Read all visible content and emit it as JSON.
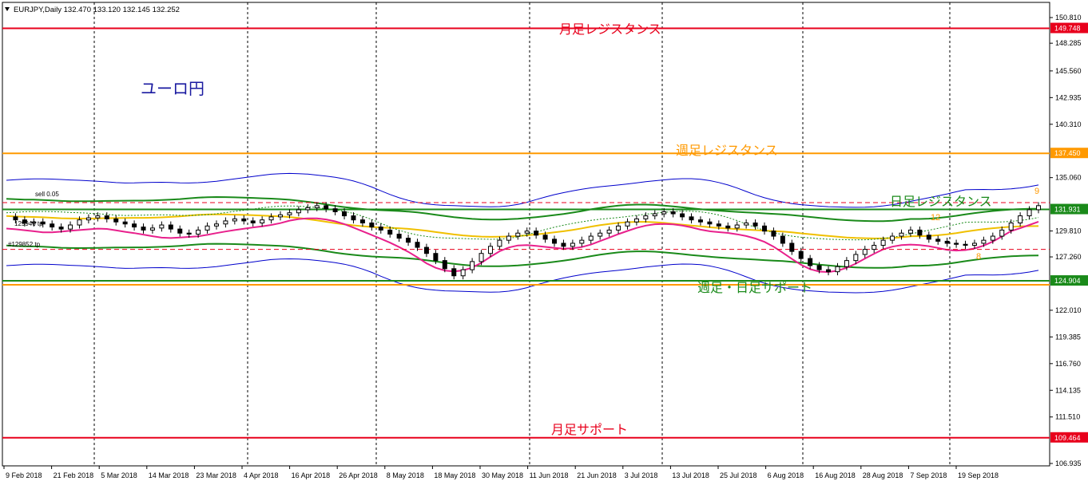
{
  "header": {
    "icon": "triangle-down-icon",
    "text": "EURJPY,Daily  132.470 133.120 132.145 132.252"
  },
  "annotations": {
    "title": "ユーロ円",
    "monthly_resistance": "月足レジスタンス",
    "weekly_resistance": "週足レジスタンス",
    "daily_resistance": "日足レジスタンス",
    "weekly_daily_support": "週足・日足サポート",
    "monthly_support": "月足サポート",
    "sell_label": "sell 0.05",
    "tp1": "129946 tp",
    "tp2": "#129852 tp",
    "count_12": "12",
    "count_9": "9",
    "count_8": "8"
  },
  "colors": {
    "red": "#e8001c",
    "orange": "#ff9900",
    "green": "#1a8a1a",
    "blue": "#0000cc",
    "magenta": "#e8208c",
    "yellow": "#f0c000",
    "title_blue": "#1a1aa0"
  },
  "chart_data": {
    "type": "line",
    "y_ticks": [
      "150.810",
      "149.748",
      "148.285",
      "145.560",
      "142.935",
      "140.310",
      "137.450",
      "135.060",
      "131.931",
      "129.810",
      "127.260",
      "124.904",
      "122.010",
      "119.385",
      "116.760",
      "114.135",
      "111.510",
      "109.464",
      "106.935"
    ],
    "ylim": [
      106.3,
      151.5
    ],
    "x_ticks": [
      "9 Feb 2018",
      "21 Feb 2018",
      "5 Mar 2018",
      "14 Mar 2018",
      "23 Mar 2018",
      "4 Apr 2018",
      "16 Apr 2018",
      "26 Apr 2018",
      "8 May 2018",
      "18 May 2018",
      "30 May 2018",
      "11 Jun 2018",
      "21 Jun 2018",
      "3 Jul 2018",
      "13 Jul 2018",
      "25 Jul 2018",
      "6 Aug 2018",
      "16 Aug 2018",
      "28 Aug 2018",
      "7 Sep 2018",
      "19 Sep 2018"
    ],
    "levels": [
      {
        "value": 149.748,
        "label": "149.748",
        "color": "#e8001c"
      },
      {
        "value": 137.45,
        "label": "137.450",
        "color": "#ff9900"
      },
      {
        "value": 131.931,
        "label": "131.931",
        "color": "#1a8a1a"
      },
      {
        "value": 124.904,
        "label": "124.904",
        "color": "#1a8a1a"
      },
      {
        "value": 109.464,
        "label": "109.464",
        "color": "#e8001c"
      }
    ],
    "close_series": [
      131.2,
      130.9,
      130.6,
      130.7,
      130.5,
      130.2,
      130.0,
      130.4,
      130.9,
      131.1,
      131.3,
      131.0,
      130.7,
      130.5,
      130.2,
      129.9,
      130.1,
      130.4,
      130.0,
      129.6,
      129.5,
      129.9,
      130.3,
      130.5,
      130.8,
      131.0,
      130.8,
      130.6,
      130.9,
      131.2,
      131.4,
      131.6,
      131.9,
      132.1,
      132.3,
      132.0,
      131.7,
      131.3,
      130.9,
      130.6,
      130.2,
      129.9,
      129.5,
      129.1,
      128.7,
      128.2,
      127.6,
      126.9,
      126.1,
      125.4,
      126.0,
      126.8,
      127.6,
      128.3,
      128.9,
      129.3,
      129.6,
      129.8,
      129.4,
      129.0,
      128.6,
      128.3,
      128.6,
      128.9,
      129.3,
      129.6,
      129.9,
      130.3,
      130.7,
      131.0,
      131.3,
      131.5,
      131.7,
      131.5,
      131.2,
      130.9,
      130.7,
      130.5,
      130.3,
      130.1,
      130.4,
      130.6,
      130.3,
      129.8,
      129.3,
      128.6,
      127.8,
      127.1,
      126.4,
      126.0,
      125.8,
      126.3,
      126.9,
      127.5,
      128.0,
      128.4,
      128.9,
      129.3,
      129.6,
      129.9,
      129.4,
      129.0,
      128.8,
      128.6,
      128.5,
      128.4,
      128.6,
      128.9,
      129.3,
      129.9,
      130.6,
      131.3,
      131.9,
      132.3
    ]
  }
}
